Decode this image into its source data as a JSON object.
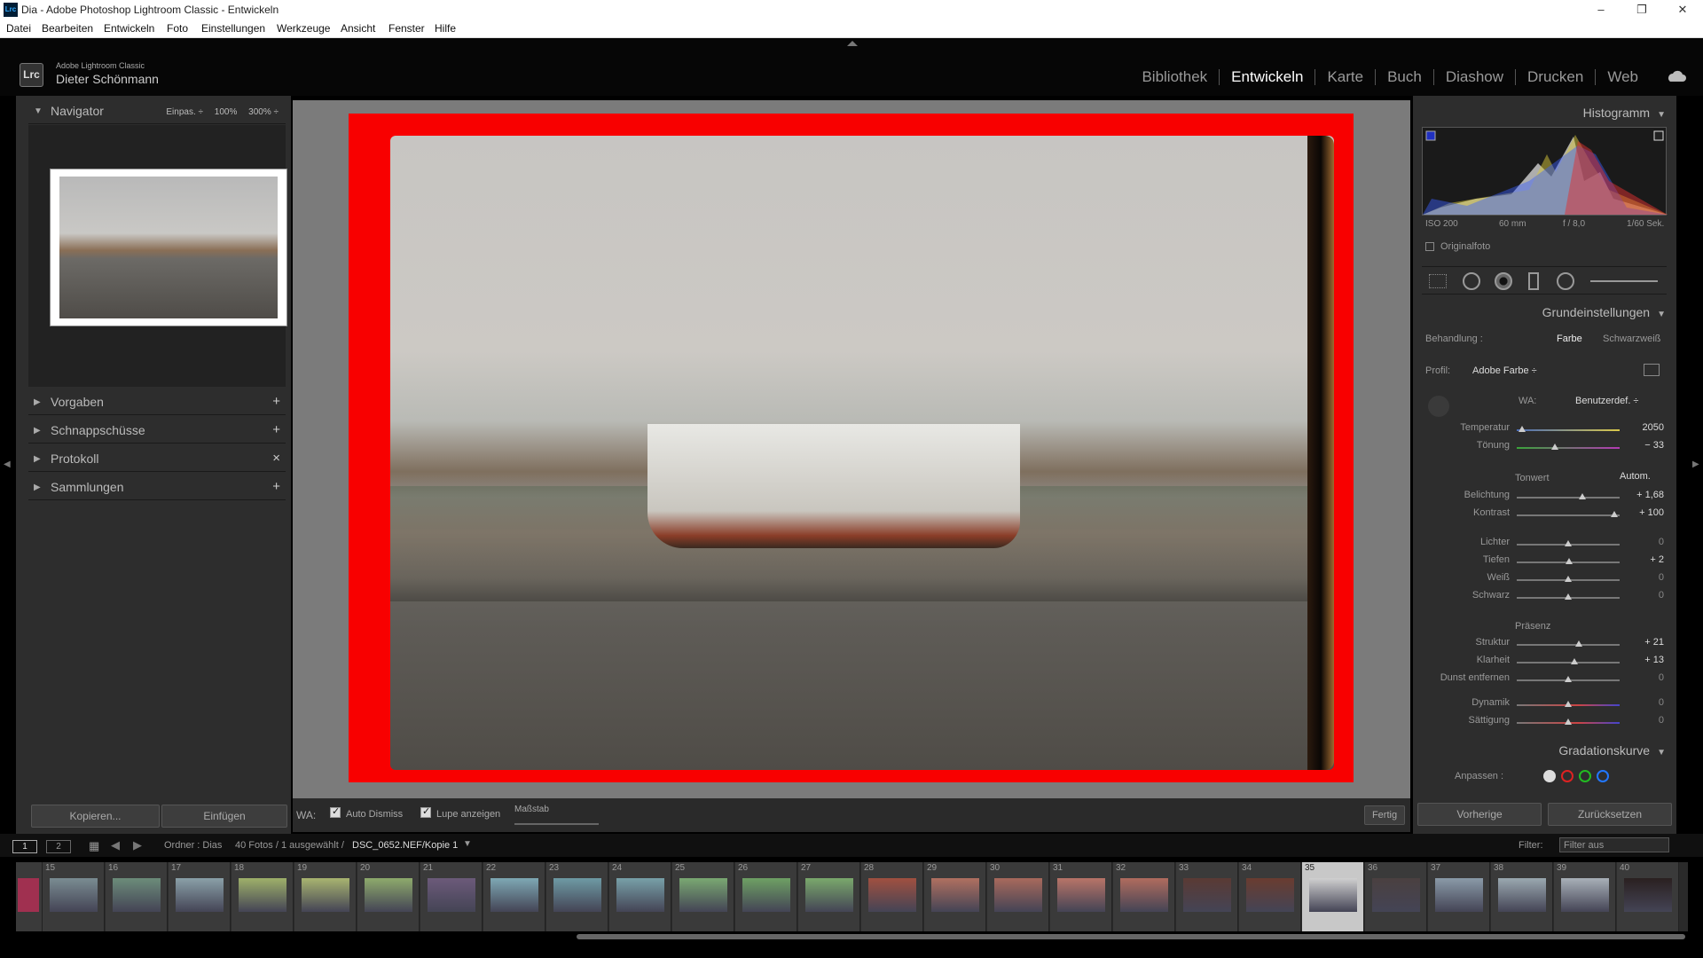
{
  "window": {
    "title": "Dia - Adobe Photoshop Lightroom Classic - Entwickeln",
    "app_icon": "Lrc",
    "min": "–",
    "max": "❐",
    "close": "✕"
  },
  "menubar": [
    "Datei",
    "Bearbeiten",
    "Entwickeln",
    "Foto",
    "Einstellungen",
    "Werkzeuge",
    "Ansicht",
    "Fenster",
    "Hilfe"
  ],
  "header": {
    "logo": "Lrc",
    "brand_line1": "Adobe Lightroom Classic",
    "brand_line2": "Dieter Schönmann",
    "modules": [
      "Bibliothek",
      "Entwickeln",
      "Karte",
      "Buch",
      "Diashow",
      "Drucken",
      "Web"
    ],
    "active_module": "Entwickeln"
  },
  "left": {
    "navigator": {
      "label": "Navigator",
      "opts": [
        "Einpas. ÷",
        "100%",
        "300% ÷"
      ]
    },
    "panels": [
      {
        "label": "Vorgaben",
        "action": "+"
      },
      {
        "label": "Schnappschüsse",
        "action": "+"
      },
      {
        "label": "Protokoll",
        "action": "×"
      },
      {
        "label": "Sammlungen",
        "action": "+"
      }
    ],
    "copy_button": "Kopieren...",
    "paste_button": "Einfügen"
  },
  "toolbar": {
    "wa_label": "WA:",
    "auto_dismiss": "Auto Dismiss",
    "loupe": "Lupe anzeigen",
    "scale": "Maßstab",
    "done": "Fertig"
  },
  "right": {
    "histogram_label": "Histogramm",
    "exif": [
      "ISO 200",
      "60 mm",
      "f / 8,0",
      "1/60 Sek."
    ],
    "original_photo": "Originalfoto",
    "basic_label": "Grundeinstellungen",
    "treatment_label": "Behandlung :",
    "treatment_color": "Farbe",
    "treatment_bw": "Schwarzweiß",
    "profile_label": "Profil:",
    "profile_value": "Adobe Farbe ÷",
    "wb_label": "WA:",
    "wb_value": "Benutzerdef. ÷",
    "tone_label": "Tonwert",
    "auto_label": "Autom.",
    "presence_label": "Präsenz",
    "sliders": [
      {
        "label": "Temperatur",
        "value": "2050",
        "pos": 0.05
      },
      {
        "label": "Tönung",
        "value": "− 33",
        "pos": 0.37
      },
      {
        "label": "Belichtung",
        "value": "+ 1,68",
        "pos": 0.64
      },
      {
        "label": "Kontrast",
        "value": "+ 100",
        "pos": 0.95
      },
      {
        "label": "Lichter",
        "value": "0",
        "pos": 0.5
      },
      {
        "label": "Tiefen",
        "value": "+ 2",
        "pos": 0.51
      },
      {
        "label": "Weiß",
        "value": "0",
        "pos": 0.5
      },
      {
        "label": "Schwarz",
        "value": "0",
        "pos": 0.5
      },
      {
        "label": "Struktur",
        "value": "+ 21",
        "pos": 0.6
      },
      {
        "label": "Klarheit",
        "value": "+ 13",
        "pos": 0.56
      },
      {
        "label": "Dunst entfernen",
        "value": "0",
        "pos": 0.5
      },
      {
        "label": "Dynamik",
        "value": "0",
        "pos": 0.5
      },
      {
        "label": "Sättigung",
        "value": "0",
        "pos": 0.5
      }
    ],
    "curve_label": "Gradationskurve",
    "adjust_label": "Anpassen :",
    "prev_button": "Vorherige",
    "reset_button": "Zurücksetzen"
  },
  "filmbar": {
    "view1": "1",
    "view2": "2",
    "source": "Ordner : Dias",
    "count": "40 Fotos / 1 ausgewählt /",
    "file": "DSC_0652.NEF/Kopie 1",
    "filter_label": "Filter:",
    "filter_value": "Filter aus"
  },
  "filmstrip": {
    "numbers": [
      "15",
      "16",
      "17",
      "18",
      "19",
      "20",
      "21",
      "22",
      "23",
      "24",
      "25",
      "26",
      "27",
      "28",
      "29",
      "30",
      "31",
      "32",
      "33",
      "34",
      "35",
      "36",
      "37",
      "38",
      "39",
      "40"
    ],
    "selected": "35"
  },
  "colors": {
    "accent_red": "#f80000",
    "bg": "#2d2d2d",
    "center_bg": "#7b7b7b"
  }
}
